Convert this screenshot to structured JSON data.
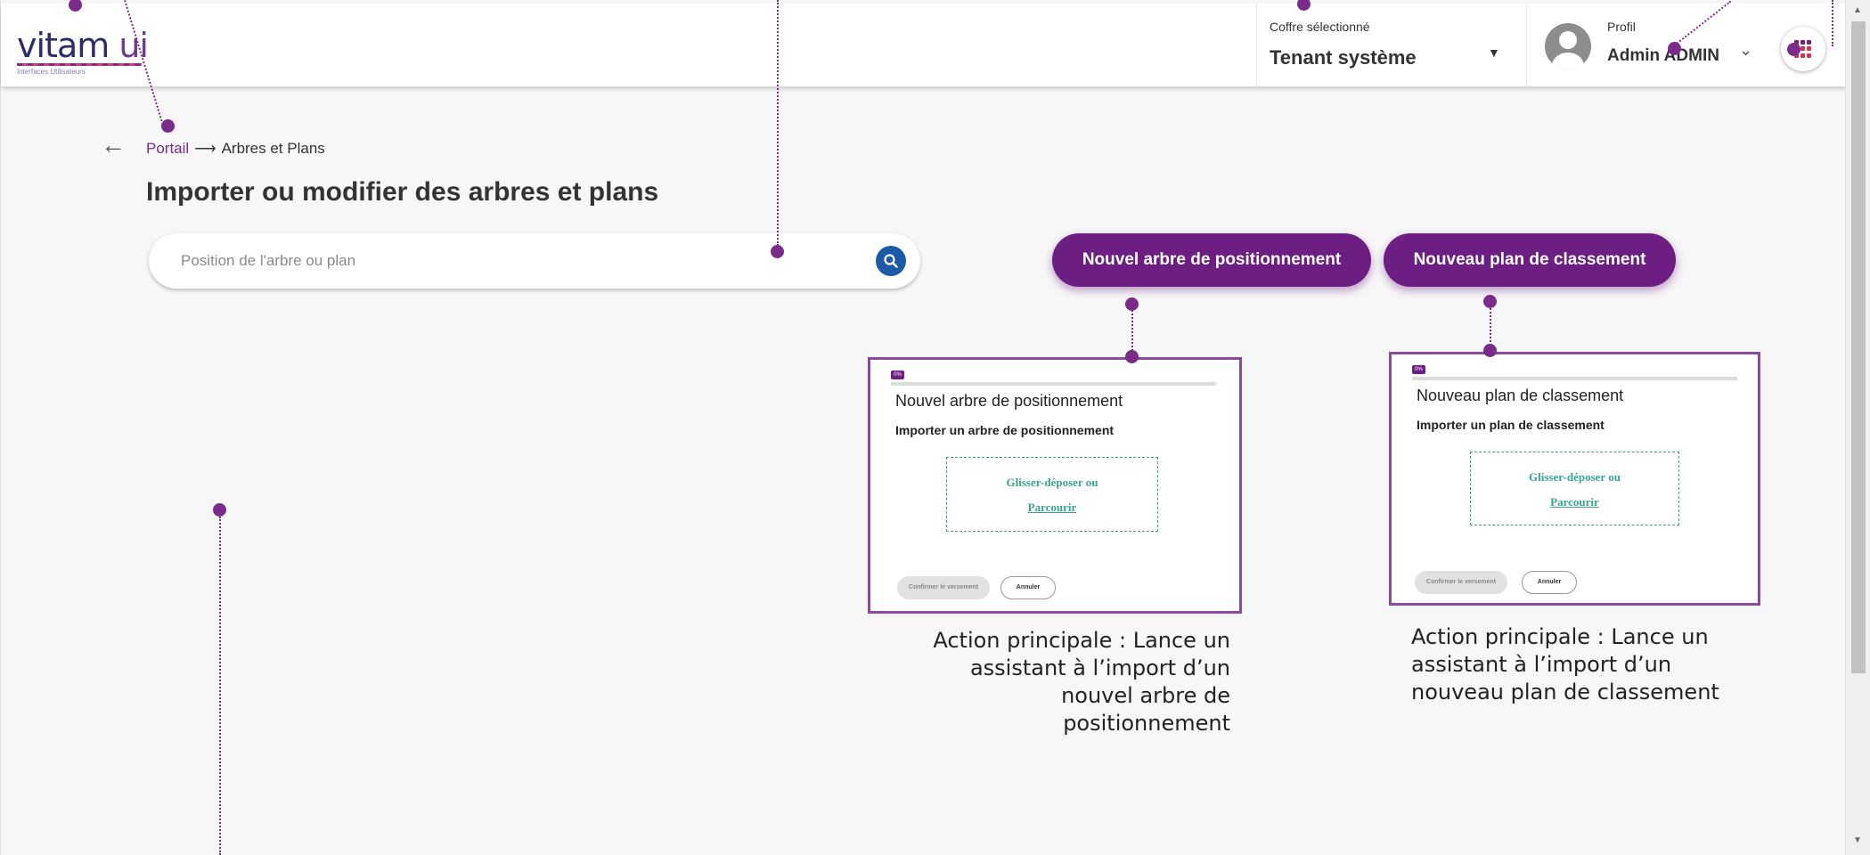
{
  "header": {
    "logo_text_a": "vitam",
    "logo_text_b": " ui",
    "logo_subtitle": "Interfaces Utilisateurs",
    "tenant_label": "Coffre sélectionné",
    "tenant_value": "Tenant système",
    "profile_label": "Profil",
    "profile_name": "Admin ADMIN"
  },
  "breadcrumb": {
    "back_icon": "arrow-left-icon",
    "parent": "Portail",
    "separator": "⟶",
    "current": "Arbres et Plans"
  },
  "page_title": "Importer ou modifier des arbres et plans",
  "search": {
    "placeholder": "Position de l'arbre ou plan",
    "icon": "search-icon"
  },
  "actions": {
    "new_tree": "Nouvel arbre de positionnement",
    "new_plan": "Nouveau plan de classement"
  },
  "callouts": {
    "tree": {
      "progress": "0%",
      "progress_value": 0,
      "title": "Nouvel arbre de positionnement",
      "subtitle": "Importer un arbre de positionnement",
      "dropzone_text": "Glisser-déposer ou",
      "dropzone_link": "Parcourir",
      "confirm": "Confirmer le versement",
      "cancel": "Annuler",
      "annotation": "Action principale : Lance un assistant à l’import d’un nouvel arbre de positionnement"
    },
    "plan": {
      "progress": "0%",
      "progress_value": 0,
      "title": "Nouveau plan de classement",
      "subtitle": "Importer un plan de classement",
      "dropzone_text": "Glisser-déposer ou",
      "dropzone_link": "Parcourir",
      "confirm": "Confirmer le versement",
      "cancel": "Annuler",
      "annotation": "Action principale : Lance un assistant à l’import d’un nouveau plan de classement"
    }
  },
  "colors": {
    "accent": "#6d1e82",
    "annotation": "#7b2b8a",
    "search_button": "#1c5aa8",
    "dropzone": "#3aa38d"
  }
}
